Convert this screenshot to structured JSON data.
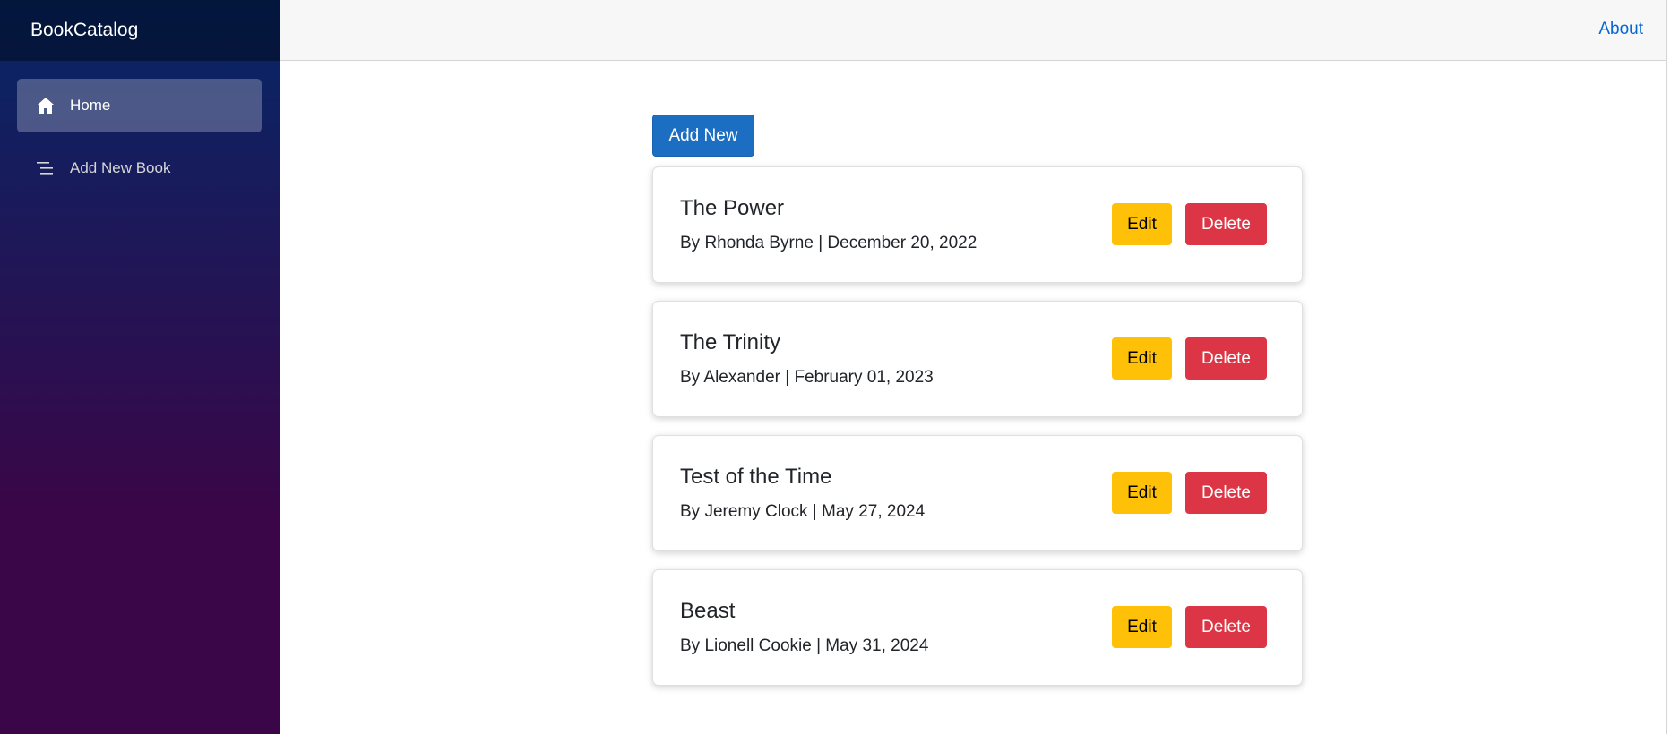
{
  "brand": "BookCatalog",
  "sidebar": {
    "items": [
      {
        "label": "Home",
        "icon": "home-icon",
        "active": true
      },
      {
        "label": "Add New Book",
        "icon": "list-icon",
        "active": false
      }
    ]
  },
  "topbar": {
    "about_label": "About"
  },
  "main": {
    "add_new_label": "Add New",
    "books": [
      {
        "title": "The Power",
        "meta": "By Rhonda Byrne | December 20, 2022",
        "edit_label": "Edit",
        "delete_label": "Delete"
      },
      {
        "title": "The Trinity",
        "meta": "By Alexander | February 01, 2023",
        "edit_label": "Edit",
        "delete_label": "Delete"
      },
      {
        "title": "Test of the Time",
        "meta": "By Jeremy Clock | May 27, 2024",
        "edit_label": "Edit",
        "delete_label": "Delete"
      },
      {
        "title": "Beast",
        "meta": "By Lionell Cookie | May 31, 2024",
        "edit_label": "Edit",
        "delete_label": "Delete"
      }
    ]
  },
  "colors": {
    "sidebar_top": "#052767",
    "sidebar_bottom": "#3a0647",
    "primary": "#1b6ec2",
    "warning": "#ffc107",
    "danger": "#dc3545",
    "link": "#0366d6"
  }
}
